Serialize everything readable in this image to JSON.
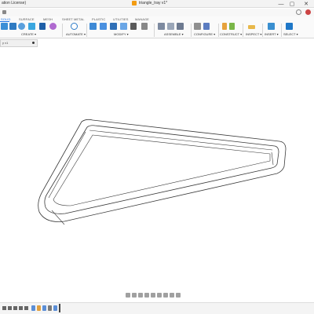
{
  "window": {
    "license_text": "ation License)",
    "document_title": "triangle_tray v1*",
    "close_glyph": "✕",
    "maximize_glyph": "▢",
    "minimize_glyph": "—"
  },
  "tabs": [
    {
      "label": "SOLID",
      "active": true
    },
    {
      "label": "SURFACE",
      "active": false
    },
    {
      "label": "MESH",
      "active": false
    },
    {
      "label": "SHEET METAL",
      "active": false
    },
    {
      "label": "PLASTIC",
      "active": false
    },
    {
      "label": "UTILITIES",
      "active": false
    },
    {
      "label": "MANAGE",
      "active": false
    }
  ],
  "ribbon_groups": {
    "create": "CREATE ▾",
    "automate": "AUTOMATE ▾",
    "modify": "MODIFY ▾",
    "assemble": "ASSEMBLE ▾",
    "configure": "CONFIGURE ▾",
    "construct": "CONSTRUCT ▾",
    "inspect": "INSPECT ▾",
    "insert": "INSERT ▾",
    "select": "SELECT ▾"
  },
  "browser": {
    "name": "y v1"
  },
  "colors": {
    "accent": "#1a73e8",
    "model_line": "#3a3a3a",
    "model_fill": "#ffffff"
  }
}
